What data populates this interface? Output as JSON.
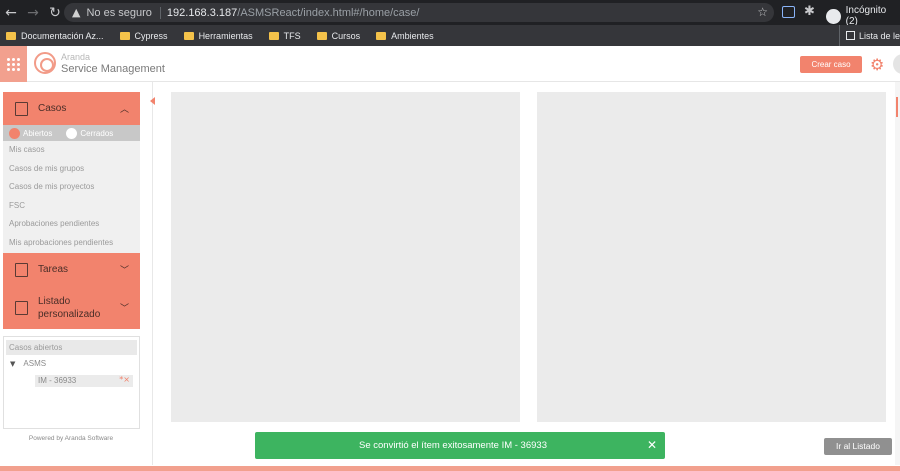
{
  "browser": {
    "security_label": "No es seguro",
    "url_host": "192.168.3.187",
    "url_path": "/ASMSReact/index.html#/home/case/",
    "profile_label": "Incógnito (2)",
    "bookmarks": [
      "Documentación Az...",
      "Cypress",
      "Herramientas",
      "TFS",
      "Cursos",
      "Ambientes"
    ],
    "reading_list": "Lista de le"
  },
  "header": {
    "brand_sub": "Aranda",
    "brand_main": "Service Management",
    "create_button": "Crear caso"
  },
  "sidebar": {
    "casos_label": "Casos",
    "filter_open": "Abiertos",
    "filter_closed": "Cerrados",
    "case_items": [
      "Mis casos",
      "Casos de mis grupos",
      "Casos de mis proyectos",
      "FSC",
      "Aprobaciones pendientes",
      "Mis aprobaciones pendientes"
    ],
    "tareas_label": "Tareas",
    "listado_label": "Listado personalizado",
    "open_cases_title": "Casos abiertos",
    "tree_node": "ASMS",
    "tree_item": "IM - 36933",
    "powered_by": "Powered by Aranda Software"
  },
  "toast": {
    "message": "Se convirtió el ítem exitosamente IM - 36933"
  },
  "actions": {
    "go_to_list": "Ir al Listado"
  },
  "colors": {
    "accent": "#f2836d",
    "toast": "#3db460"
  }
}
